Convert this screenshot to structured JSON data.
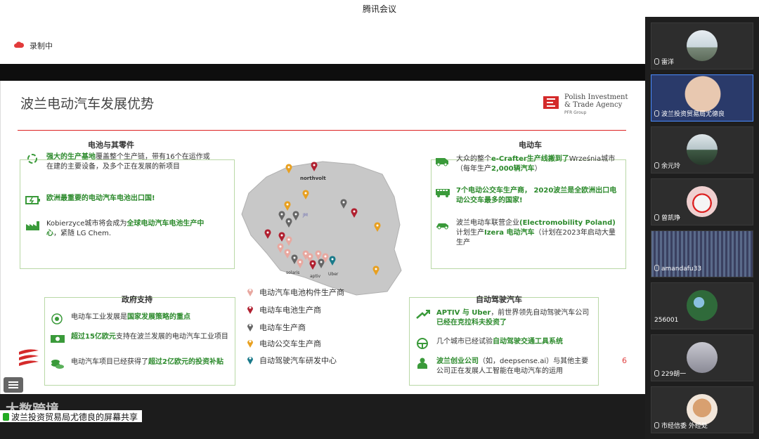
{
  "window": {
    "title": "腾讯会议"
  },
  "recording": {
    "label": "录制中"
  },
  "slide": {
    "title": "波兰电动汽车发展优势",
    "logo": {
      "line1": "Polish Investment",
      "line2": "& Trade Agency",
      "line3": "PFR Group"
    },
    "page_number": "6",
    "battery": {
      "heading": "电池与其零件",
      "items": [
        {
          "icon": "recycle-icon",
          "parts": [
            {
              "t": "强大的生产基地",
              "g": true
            },
            {
              "t": "覆盖整个生产链，带有16个在运作或在建的主要设备，及多个正在发展的新项目",
              "g": false
            }
          ]
        },
        {
          "icon": "battery-icon",
          "parts": [
            {
              "t": "欧洲最重要的电动汽车电池出口国!",
              "g": true
            }
          ]
        },
        {
          "icon": "factory-icon",
          "parts": [
            {
              "t": "Kobierzyce城市将会成为",
              "g": false
            },
            {
              "t": "全球电动汽车电池生产中心",
              "g": true
            },
            {
              "t": "，紧随 LG Chem.",
              "g": false
            }
          ]
        }
      ]
    },
    "vehicles": {
      "heading": "电动车",
      "items": [
        {
          "icon": "van-icon",
          "parts": [
            {
              "t": "大众的整个",
              "g": false
            },
            {
              "t": "e-Crafter生产线搬到了",
              "g": true
            },
            {
              "t": "Września城市（每年生产",
              "g": false
            },
            {
              "t": "2,000辆汽车",
              "g": true
            },
            {
              "t": "）",
              "g": false
            }
          ]
        },
        {
          "icon": "bus-icon",
          "parts": [
            {
              "t": "7个电动公交车生产商， 2020波兰是全欧洲出口电动公交车最多的国家!",
              "g": true
            }
          ]
        },
        {
          "icon": "car-icon",
          "parts": [
            {
              "t": "波兰电动车联营企业",
              "g": false
            },
            {
              "t": "(Electromobility Poland)",
              "g": true
            },
            {
              "t": "计划生产",
              "g": false
            },
            {
              "t": "Izera 电动汽车",
              "g": true
            },
            {
              "t": "（计划在2023年启动大量生产",
              "g": false
            }
          ]
        }
      ]
    },
    "government": {
      "heading": "政府支持",
      "items": [
        {
          "icon": "target-icon",
          "parts": [
            {
              "t": "电动车工业发展是",
              "g": false
            },
            {
              "t": "国家发展策略的重点",
              "g": true
            }
          ]
        },
        {
          "icon": "money-icon",
          "parts": [
            {
              "t": "超过15亿欧元",
              "g": true
            },
            {
              "t": "支持在波兰发展的电动汽车工业项目",
              "g": false
            }
          ]
        },
        {
          "icon": "coins-icon",
          "parts": [
            {
              "t": "电动汽车项目已经获得了",
              "g": false
            },
            {
              "t": "超过2亿欧元的投资补贴",
              "g": true
            }
          ]
        }
      ]
    },
    "autonomous": {
      "heading": "自动驾驶汽车",
      "items": [
        {
          "icon": "trend-arrow-icon",
          "parts": [
            {
              "t": "APTIV 与 Uber",
              "g": true
            },
            {
              "t": "，前世界领先自动驾驶汽车公司",
              "g": false
            },
            {
              "t": "已经在克拉科夫投资了",
              "g": true
            }
          ]
        },
        {
          "icon": "steering-wheel-icon",
          "parts": [
            {
              "t": "几个城市已经试验",
              "g": false
            },
            {
              "t": "自动驾驶交通工具系统",
              "g": true
            }
          ]
        },
        {
          "icon": "person-icon",
          "parts": [
            {
              "t": "波兰创业公司",
              "g": true
            },
            {
              "t": "（如，deepsense.ai）与其他主要公司正在发展人工智能在电动汽车的运用",
              "g": false
            }
          ]
        }
      ]
    },
    "legend": [
      {
        "label": "电动汽车电池构件生产商",
        "color": "#e8a8a0"
      },
      {
        "label": "电动车电池生产商",
        "color": "#b02030"
      },
      {
        "label": "电动车生产商",
        "color": "#666666"
      },
      {
        "label": "电动公交车生产商",
        "color": "#e8a020"
      },
      {
        "label": "自动驾驶汽车研发中心",
        "color": "#1a7a8a"
      }
    ],
    "map_labels": [
      "northvolt",
      "solaris",
      "JM",
      "Uber",
      "aptiv"
    ]
  },
  "bottom": {
    "watermark": "大数跨境",
    "share_label": "波兰投资贸易局尤德良的屏幕共享"
  },
  "participants": [
    {
      "name": "雷洋",
      "mic": true
    },
    {
      "name": "波兰投资贸易局尤德良",
      "mic": true
    },
    {
      "name": "余元玲",
      "mic": true
    },
    {
      "name": "曾凯琤",
      "mic": true
    },
    {
      "name": "amandafu33",
      "mic": true
    },
    {
      "name": "256001",
      "mic": false
    },
    {
      "name": "229胡一",
      "mic": true
    },
    {
      "name": "市经信委 外经处",
      "mic": true
    }
  ]
}
